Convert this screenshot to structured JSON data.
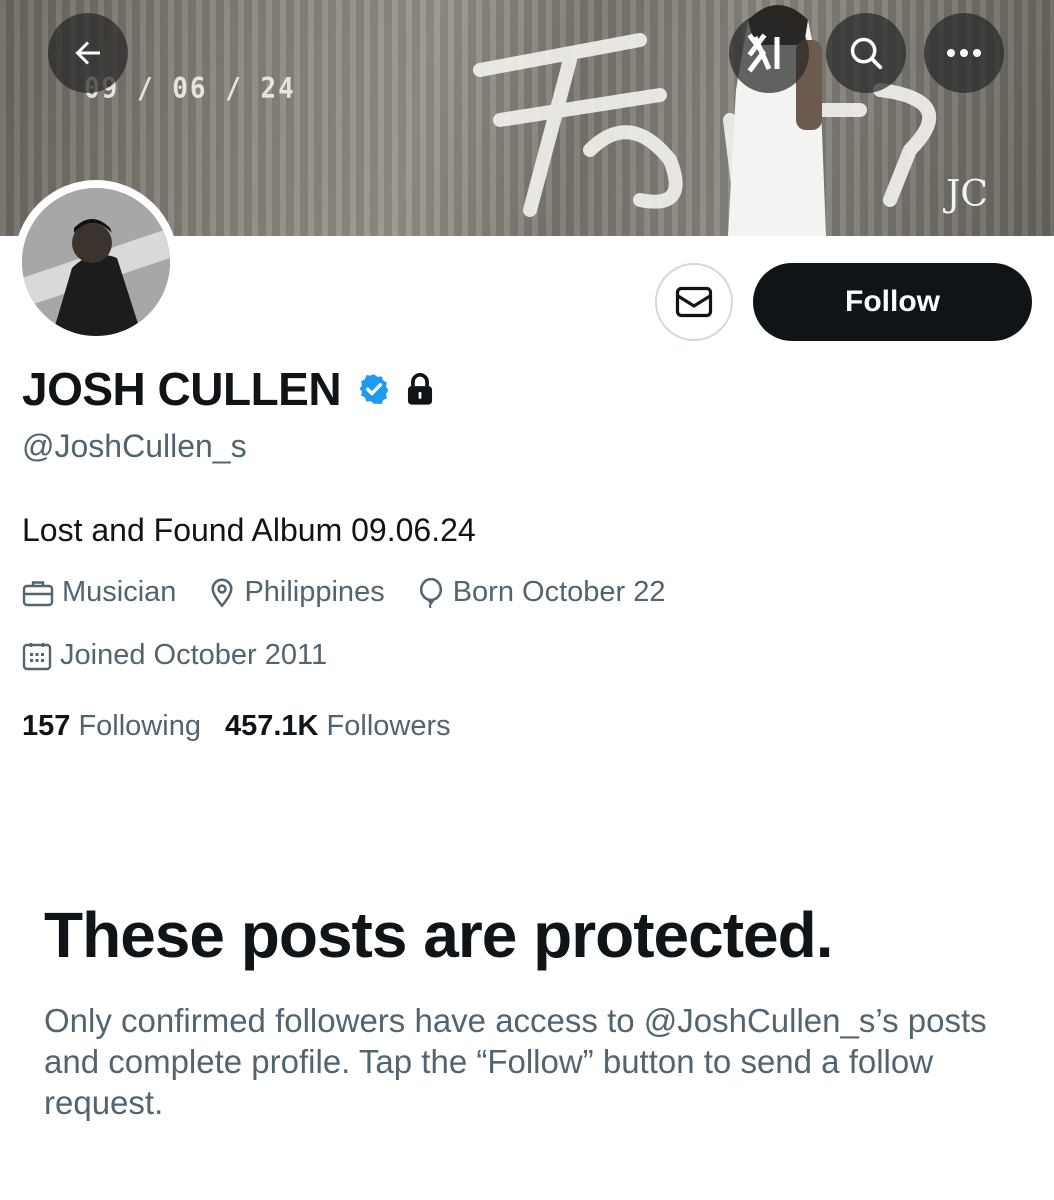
{
  "banner": {
    "date_text": "09 / 06 / 24",
    "logo_text": "JC"
  },
  "profile": {
    "name": "JOSH CULLEN",
    "handle": "@JoshCullen_s",
    "bio": "Lost and Found Album 09.06.24",
    "profession": "Musician",
    "location": "Philippines",
    "birthday": "Born October 22",
    "joined": "Joined October 2011",
    "following_count": "157",
    "following_label": "Following",
    "followers_count": "457.1K",
    "followers_label": "Followers"
  },
  "actions": {
    "follow_label": "Follow"
  },
  "protected": {
    "title": "These posts are protected.",
    "description": "Only confirmed followers have access to @JoshCullen_s’s posts and complete profile. Tap the “Follow” button to send a follow request."
  },
  "icons": {
    "back": "arrow-left-icon",
    "grok": "grok-icon",
    "search": "search-icon",
    "more": "more-icon",
    "message": "envelope-icon",
    "verified": "verified-badge-icon",
    "lock": "lock-icon",
    "profession": "briefcase-icon",
    "location": "location-pin-icon",
    "birthday": "balloon-icon",
    "joined": "calendar-icon"
  },
  "colors": {
    "verified_blue": "#1d9bf0",
    "text_primary": "#0f1419",
    "text_secondary": "#536471",
    "follow_button_bg": "#0f1419"
  }
}
